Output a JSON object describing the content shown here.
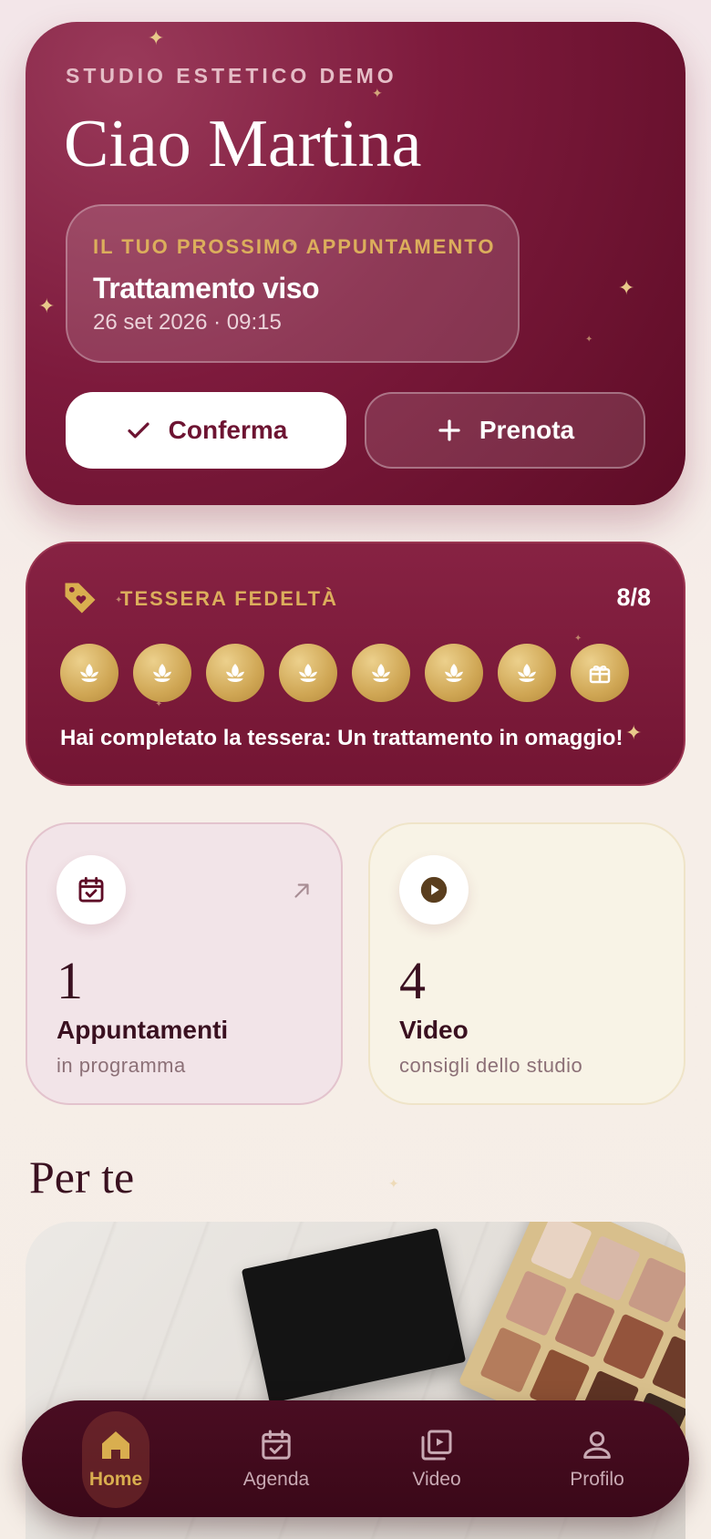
{
  "hero": {
    "studio_name": "STUDIO ESTETICO DEMO",
    "greeting": "Ciao Martina",
    "next_appointment": {
      "label": "IL TUO PROSSIMO APPUNTAMENTO",
      "treatment": "Trattamento viso",
      "datetime": "26 set 2026 · 09:15"
    },
    "confirm_label": "Conferma",
    "book_label": "Prenota"
  },
  "loyalty": {
    "title": "TESSERA FEDELTÀ",
    "count": "8/8",
    "stamps_filled": 7,
    "stamps_total": 8,
    "reward_icon": "gift-icon",
    "message": "Hai completato la tessera: Un trattamento in omaggio!"
  },
  "stats": {
    "appointments": {
      "value": "1",
      "title": "Appuntamenti",
      "subtitle": "in programma",
      "icon": "calendar-check-icon"
    },
    "videos": {
      "value": "4",
      "title": "Video",
      "subtitle": "consigli dello studio",
      "icon": "play-icon"
    }
  },
  "section": {
    "title": "Per te"
  },
  "nav": {
    "items": [
      {
        "label": "Home",
        "icon": "home-icon",
        "active": true
      },
      {
        "label": "Agenda",
        "icon": "calendar-icon",
        "active": false
      },
      {
        "label": "Video",
        "icon": "video-library-icon",
        "active": false
      },
      {
        "label": "Profilo",
        "icon": "user-icon",
        "active": false
      }
    ]
  },
  "colors": {
    "brand": "#7d1a3c",
    "gold": "#dcae5c",
    "nav_bg": "#3a0818"
  }
}
